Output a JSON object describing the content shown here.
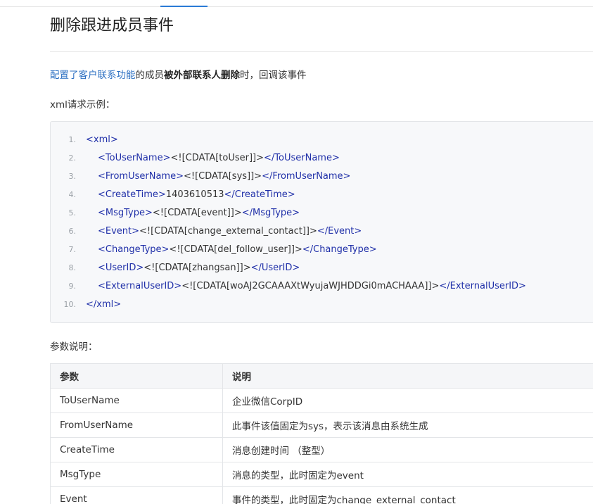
{
  "page": {
    "title": "删除跟进成员事件",
    "intro": {
      "link_text": "配置了客户联系功能",
      "text_1": "的成员",
      "bold_text": "被外部联系人删除",
      "text_2": "时，回调该事件"
    },
    "xml_label": "xml请求示例：",
    "params_label": "参数说明："
  },
  "code_lines": [
    {
      "num": "1.",
      "parts": [
        {
          "t": "<xml>",
          "c": "tag"
        }
      ]
    },
    {
      "num": "2.",
      "parts": [
        {
          "t": "<ToUserName>",
          "c": "tag"
        },
        {
          "t": "<![CDATA[toUser]]>",
          "c": "txt"
        },
        {
          "t": "</ToUserName>",
          "c": "tag"
        }
      ]
    },
    {
      "num": "3.",
      "parts": [
        {
          "t": "<FromUserName>",
          "c": "tag"
        },
        {
          "t": "<![CDATA[sys]]>",
          "c": "txt"
        },
        {
          "t": "</FromUserName>",
          "c": "tag"
        }
      ]
    },
    {
      "num": "4.",
      "parts": [
        {
          "t": "<CreateTime>",
          "c": "tag"
        },
        {
          "t": "1403610513",
          "c": "txt"
        },
        {
          "t": "</CreateTime>",
          "c": "tag"
        }
      ]
    },
    {
      "num": "5.",
      "parts": [
        {
          "t": "<MsgType>",
          "c": "tag"
        },
        {
          "t": "<![CDATA[event]]>",
          "c": "txt"
        },
        {
          "t": "</MsgType>",
          "c": "tag"
        }
      ]
    },
    {
      "num": "6.",
      "parts": [
        {
          "t": "<Event>",
          "c": "tag"
        },
        {
          "t": "<![CDATA[change_external_contact]]>",
          "c": "txt"
        },
        {
          "t": "</Event>",
          "c": "tag"
        }
      ]
    },
    {
      "num": "7.",
      "parts": [
        {
          "t": "<ChangeType>",
          "c": "tag"
        },
        {
          "t": "<![CDATA[del_follow_user]]>",
          "c": "txt"
        },
        {
          "t": "</ChangeType>",
          "c": "tag"
        }
      ]
    },
    {
      "num": "8.",
      "parts": [
        {
          "t": "<UserID>",
          "c": "tag"
        },
        {
          "t": "<![CDATA[zhangsan]]>",
          "c": "txt"
        },
        {
          "t": "</UserID>",
          "c": "tag"
        }
      ]
    },
    {
      "num": "9.",
      "parts": [
        {
          "t": "<ExternalUserID>",
          "c": "tag"
        },
        {
          "t": "<![CDATA[woAJ2GCAAAXtWyujaWJHDDGi0mACHAAA]]>",
          "c": "txt"
        },
        {
          "t": "</ExternalUserID>",
          "c": "tag"
        }
      ]
    },
    {
      "num": "10.",
      "parts": [
        {
          "t": "</xml>",
          "c": "tag"
        }
      ]
    }
  ],
  "table": {
    "headers": [
      "参数",
      "说明"
    ],
    "rows": [
      [
        "ToUserName",
        "企业微信CorpID"
      ],
      [
        "FromUserName",
        "此事件该值固定为sys，表示该消息由系统生成"
      ],
      [
        "CreateTime",
        "消息创建时间 （整型）"
      ],
      [
        "MsgType",
        "消息的类型，此时固定为event"
      ],
      [
        "Event",
        "事件的类型，此时固定为change_external_contact"
      ]
    ]
  },
  "colors": {
    "accent": "#2b7bd6",
    "link": "#2b6fc2",
    "tag": "#1f2fa8"
  }
}
